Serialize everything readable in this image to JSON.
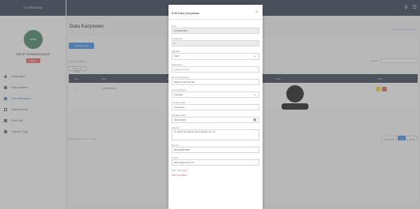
{
  "brand": "SI KARYAWAN",
  "user": {
    "name": "Admin Datakaryawan",
    "badge": "Online"
  },
  "nav": [
    {
      "label": "Dashboard",
      "icon": "home-icon"
    },
    {
      "label": "Data Jabatan",
      "icon": "briefcase-icon"
    },
    {
      "label": "Data Karyawan",
      "icon": "users-icon"
    },
    {
      "label": "Data Absensi",
      "icon": "calendar-icon"
    },
    {
      "label": "Data Gaji",
      "icon": "money-icon"
    },
    {
      "label": "Laporan Gaji",
      "icon": "file-icon"
    }
  ],
  "page": {
    "title": "Data Karyawan",
    "breadcrumb": "Home / Data Karyawan",
    "add_button": "Tambah Data Karyawan",
    "show_entries": "Show 10 entries",
    "copy_button": "Copy  CSV  Excel",
    "search_label": "Search:",
    "columns": [
      "No",
      "NIK",
      "Nama",
      "Foto",
      "Aksi"
    ],
    "row": {
      "no": "1",
      "nik": "12345678901"
    },
    "info": "Showing 1 to 1 of 1 entries",
    "pager": [
      "Previous",
      "1",
      "Next"
    ]
  },
  "modal": {
    "title": "Edit Data Karyawan",
    "close": "×",
    "fields": [
      {
        "label": "NIK",
        "value": "1234567890",
        "readonly": true
      },
      {
        "label": "Id Jabatan",
        "value": "1",
        "readonly": true
      },
      {
        "label": "Jabatan",
        "value": "Staff",
        "select": true
      },
      {
        "label": "Password",
        "value": "••••••••••••••••••"
      },
      {
        "label": "Nama Karyawan",
        "value": "Muhammad Farhan"
      },
      {
        "label": "Jenis Kelamin",
        "value": "Laki-laki",
        "select": true
      },
      {
        "label": "Tempat Lahir",
        "value": "Surabaya"
      },
      {
        "label": "Tanggal Lahir",
        "value": "01/01/2000",
        "date": true
      },
      {
        "label": "Alamat",
        "value": "Jl. Raya Surabaya Gang Mawar No. 12",
        "textarea": true
      },
      {
        "label": "No Hp",
        "value": "081234567890"
      },
      {
        "label": "Email",
        "value": "farhan@gmail.com"
      },
      {
        "label": "Foto Karyawan",
        "value": ""
      }
    ],
    "photo_warning": "Pilih Foto Baru"
  },
  "colors": {
    "topbar": "#17263b",
    "primary": "#2b7bd6",
    "danger": "#d9534f",
    "warning": "#f0c419"
  }
}
